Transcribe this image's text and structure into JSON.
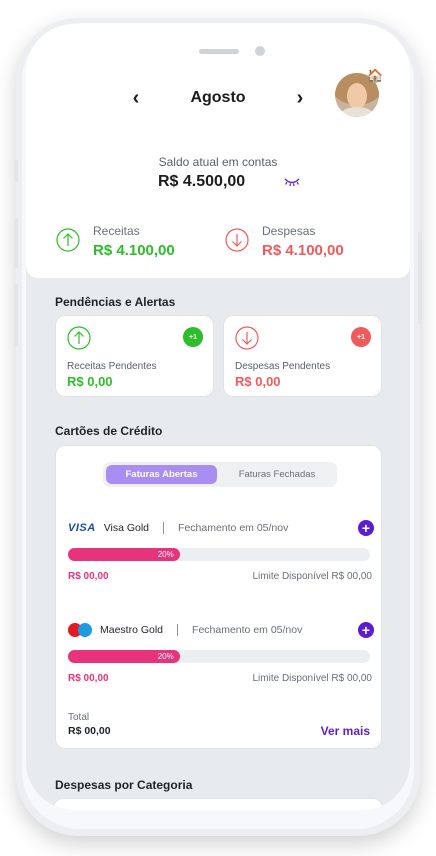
{
  "header": {
    "month": "Agosto",
    "prev_icon": "‹",
    "next_icon": "›",
    "avatar_badge": "🏠"
  },
  "balance": {
    "label": "Saldo atual em contas",
    "value": "R$ 4.500,00"
  },
  "summary": {
    "income_label": "Receitas",
    "income_value": "R$ 4.100,00",
    "expense_label": "Despesas",
    "expense_value": "R$ 4.100,00"
  },
  "alerts": {
    "title": "Pendências e Alertas",
    "income_pending_label": "Receitas Pendentes",
    "income_pending_value": "R$ 0,00",
    "income_badge": "+1",
    "expense_pending_label": "Despesas Pendentes",
    "expense_pending_value": "R$ 0,00",
    "expense_badge": "+1"
  },
  "credit_cards": {
    "title": "Cartões de Crédito",
    "tab_open": "Faturas Abertas",
    "tab_closed": "Faturas Fechadas",
    "cards": [
      {
        "brand": "VISA",
        "name": "Visa Gold",
        "closing": "Fechamento em 05/nov",
        "usage_percent": 37,
        "usage_label": "20%",
        "amount": "R$ 00,00",
        "limit": "Limite Disponível R$ 00,00"
      },
      {
        "brand": "Maestro",
        "name": "Maestro Gold",
        "closing": "Fechamento em 05/nov",
        "usage_percent": 37,
        "usage_label": "20%",
        "amount": "R$ 00,00",
        "limit": "Limite Disponível R$ 00,00"
      }
    ],
    "total_label": "Total",
    "total_value": "R$ 00,00",
    "see_more": "Ver mais",
    "add_icon": "+"
  },
  "categories": {
    "title": "Despesas por Categoria"
  },
  "colors": {
    "income": "#2ebd2a",
    "expense": "#ef5b5b",
    "accent": "#5b1ecf",
    "bar": "#e9327c"
  }
}
